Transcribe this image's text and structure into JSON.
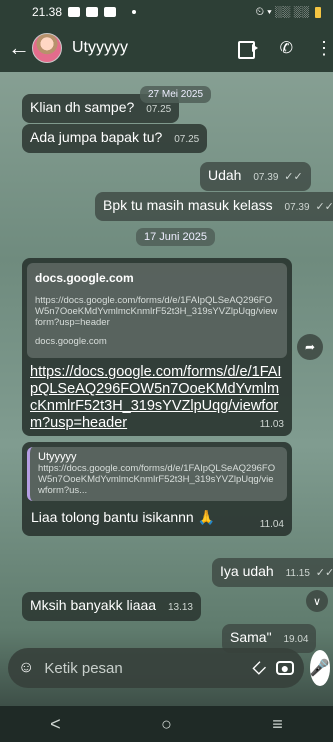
{
  "status_bar": {
    "time": "21.38",
    "right_icons": "⏲ ▾ ░░ ░░"
  },
  "header": {
    "contact_name": "Utyyyyy"
  },
  "messages": {
    "m1": {
      "text": "Klian dh sampe?",
      "date_overlay": "27 Mei 2025",
      "time": "07.25"
    },
    "m2": {
      "text": "Ada jumpa bapak tu?",
      "time": "07.25"
    },
    "m3": {
      "text": "Udah",
      "time": "07.39"
    },
    "m4": {
      "text": "Bpk tu masih masuk kelass",
      "time": "07.39"
    },
    "date_chip": "17 Juni 2025",
    "link": {
      "preview_domain": "docs.google.com",
      "preview_url": "https://docs.google.com/forms/d/e/1FAIpQLSeAQ296FOW5n7OoeKMdYvmlmcKnmlrF52t3H_319sYVZlpUqg/viewform?usp=header",
      "preview_sub": "docs.google.com",
      "text": "https://docs.google.com/forms/d/e/1FAIpQLSeAQ296FOW5n7OoeKMdYvmlmcKnmlrF52t3H_319sYVZlpUqg/viewform?usp=header",
      "time": "11.03"
    },
    "reply": {
      "quote_name": "Utyyyyy",
      "quote_text": "https://docs.google.com/forms/d/e/1FAIpQLSeAQ296FOW5n7OoeKMdYvmlmcKnmlrF52t3H_319sYVZlpUqg/viewform?us...",
      "text": "Liaa tolong bantu isikannn 🙏",
      "time": "11.04"
    },
    "m5": {
      "text": "Iya udah",
      "time": "11.15"
    },
    "m6": {
      "text": "Mksih banyakk liaaa",
      "time": "13.13"
    },
    "m7": {
      "text": "Sama\"",
      "time": "19.04"
    }
  },
  "input": {
    "placeholder": "Ketik pesan"
  },
  "nav": {
    "back": "<",
    "home": "○",
    "recents": "≡"
  },
  "icons": {
    "back": "back-arrow-icon",
    "video": "video-call-icon",
    "call": "phone-icon",
    "menu": "more-vert-icon",
    "forward": "forward-icon",
    "scroll": "chevron-down-icon",
    "emoji": "emoji-icon",
    "attach": "paperclip-icon",
    "camera": "camera-icon",
    "mic": "mic-icon"
  }
}
